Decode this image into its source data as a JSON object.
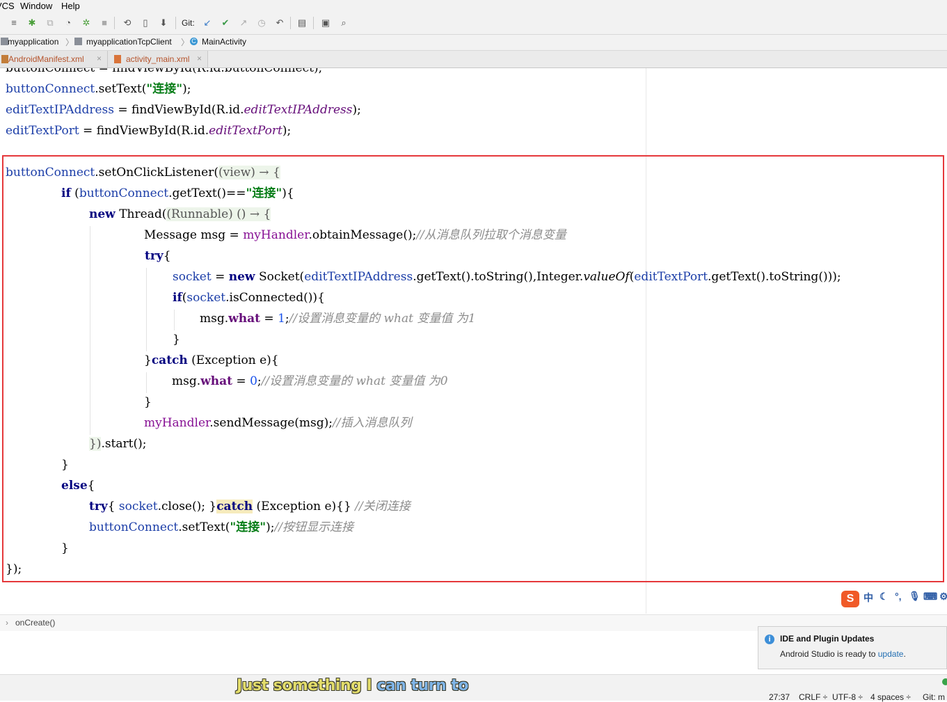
{
  "menu": {
    "vcs": "VCS",
    "window": "Window",
    "help": "Help"
  },
  "toolbar": {
    "git_label": "Git:"
  },
  "breadcrumb": {
    "project": "myapplication",
    "module": "myapplicationTcpClient",
    "class": "MainActivity",
    "class_icon_letter": "C"
  },
  "tabs": [
    {
      "label": "AndroidManifest.xml",
      "close": "×"
    },
    {
      "label": "activity_main.xml",
      "close": "×"
    }
  ],
  "code": {
    "line0": "buttonConnect = findViewById(R.id.buttonConnect);",
    "line1": {
      "a": "buttonConnect",
      "b": ".setText(",
      "s": "\"连接\"",
      "c": ");"
    },
    "line2": {
      "a": "editTextIPAddress",
      "b": " = findViewById(R.id.",
      "f": "editTextIPAddress",
      "c": ");"
    },
    "line3": {
      "a": "editTextPort",
      "b": " = findViewById(R.id.",
      "f": "editTextPort",
      "c": ");"
    },
    "line4": {
      "a": "buttonConnect",
      "b": ".setOnClickListener(",
      "fold": "(view) → {"
    },
    "line5": {
      "k": "if",
      "b": " (",
      "a": "buttonConnect",
      "c": ".getText()==",
      "s": "\"连接\"",
      "d": "){"
    },
    "line6": {
      "k": "new",
      "b": " Thread(",
      "fold": "(Runnable) () → {"
    },
    "line7": {
      "b": "Message msg = ",
      "a": "myHandler",
      "c": ".obtainMessage();",
      "cm": "//从消息队列拉取个消息变量"
    },
    "line8": {
      "k": "try",
      "b": "{"
    },
    "line9": {
      "a": "socket",
      "b": " = ",
      "k": "new",
      "c": " Socket(",
      "a2": "editTextIPAddress",
      "d": ".getText().toString(),Integer.",
      "st": "valueOf",
      "e": "(",
      "a3": "editTextPort",
      "f": ".getText().toString()));"
    },
    "line10": {
      "k": "if",
      "b": "(",
      "a": "socket",
      "c": ".isConnected()){"
    },
    "line11": {
      "b": "msg.",
      "fld": "what",
      "c": " = ",
      "n": "1",
      "d": ";",
      "cm": "//设置消息变量的 what 变量值 为1"
    },
    "line12": "}",
    "line13": {
      "b1": "}",
      "k": "catch",
      "b": " (Exception e){"
    },
    "line14": {
      "b": "msg.",
      "fld": "what",
      "c": " = ",
      "n": "0",
      "d": ";",
      "cm": "//设置消息变量的 what 变量值 为0"
    },
    "line15": "}",
    "line16": {
      "a": "myHandler",
      "b": ".sendMessage(msg);",
      "cm": "//插入消息队列"
    },
    "line17": {
      "fold": "})",
      "b": ".start();"
    },
    "line18": "}",
    "line19": {
      "k": "else",
      "b": "{"
    },
    "line20": {
      "k": "try",
      "b": "{ ",
      "a": "socket",
      "c": ".close(); }",
      "k2": "catch",
      "d": " (Exception e){} ",
      "cm": "//关闭连接"
    },
    "line21": {
      "a": "buttonConnect",
      "b": ".setText(",
      "s": "\"连接\"",
      "c": ");",
      "cm": "//按钮显示连接"
    },
    "line22": "}",
    "line23": "});"
  },
  "ime": {
    "logo": "S",
    "lang": "中",
    "moon": "☾",
    "punct": "°,",
    "mic": "🎙",
    "kbd": "⌨",
    "more": "⚙"
  },
  "structure": {
    "arrow": "›",
    "label": "onCreate()"
  },
  "notification": {
    "title": "IDE and Plugin Updates",
    "body": "Android Studio is ready to ",
    "link": "update",
    "end": "."
  },
  "subtitle": {
    "part1": "Just something I ",
    "part2": "can turn to"
  },
  "status": {
    "position": "27:37",
    "line_sep": "CRLF ÷",
    "encoding": "UTF-8 ÷",
    "indent": "4 spaces ÷",
    "git": "Git: m"
  },
  "colors": {
    "accent_box": "#e5383b",
    "keyword": "#000080",
    "string": "#067d17",
    "field": "#660e7a",
    "comment": "#8c8c8c"
  }
}
